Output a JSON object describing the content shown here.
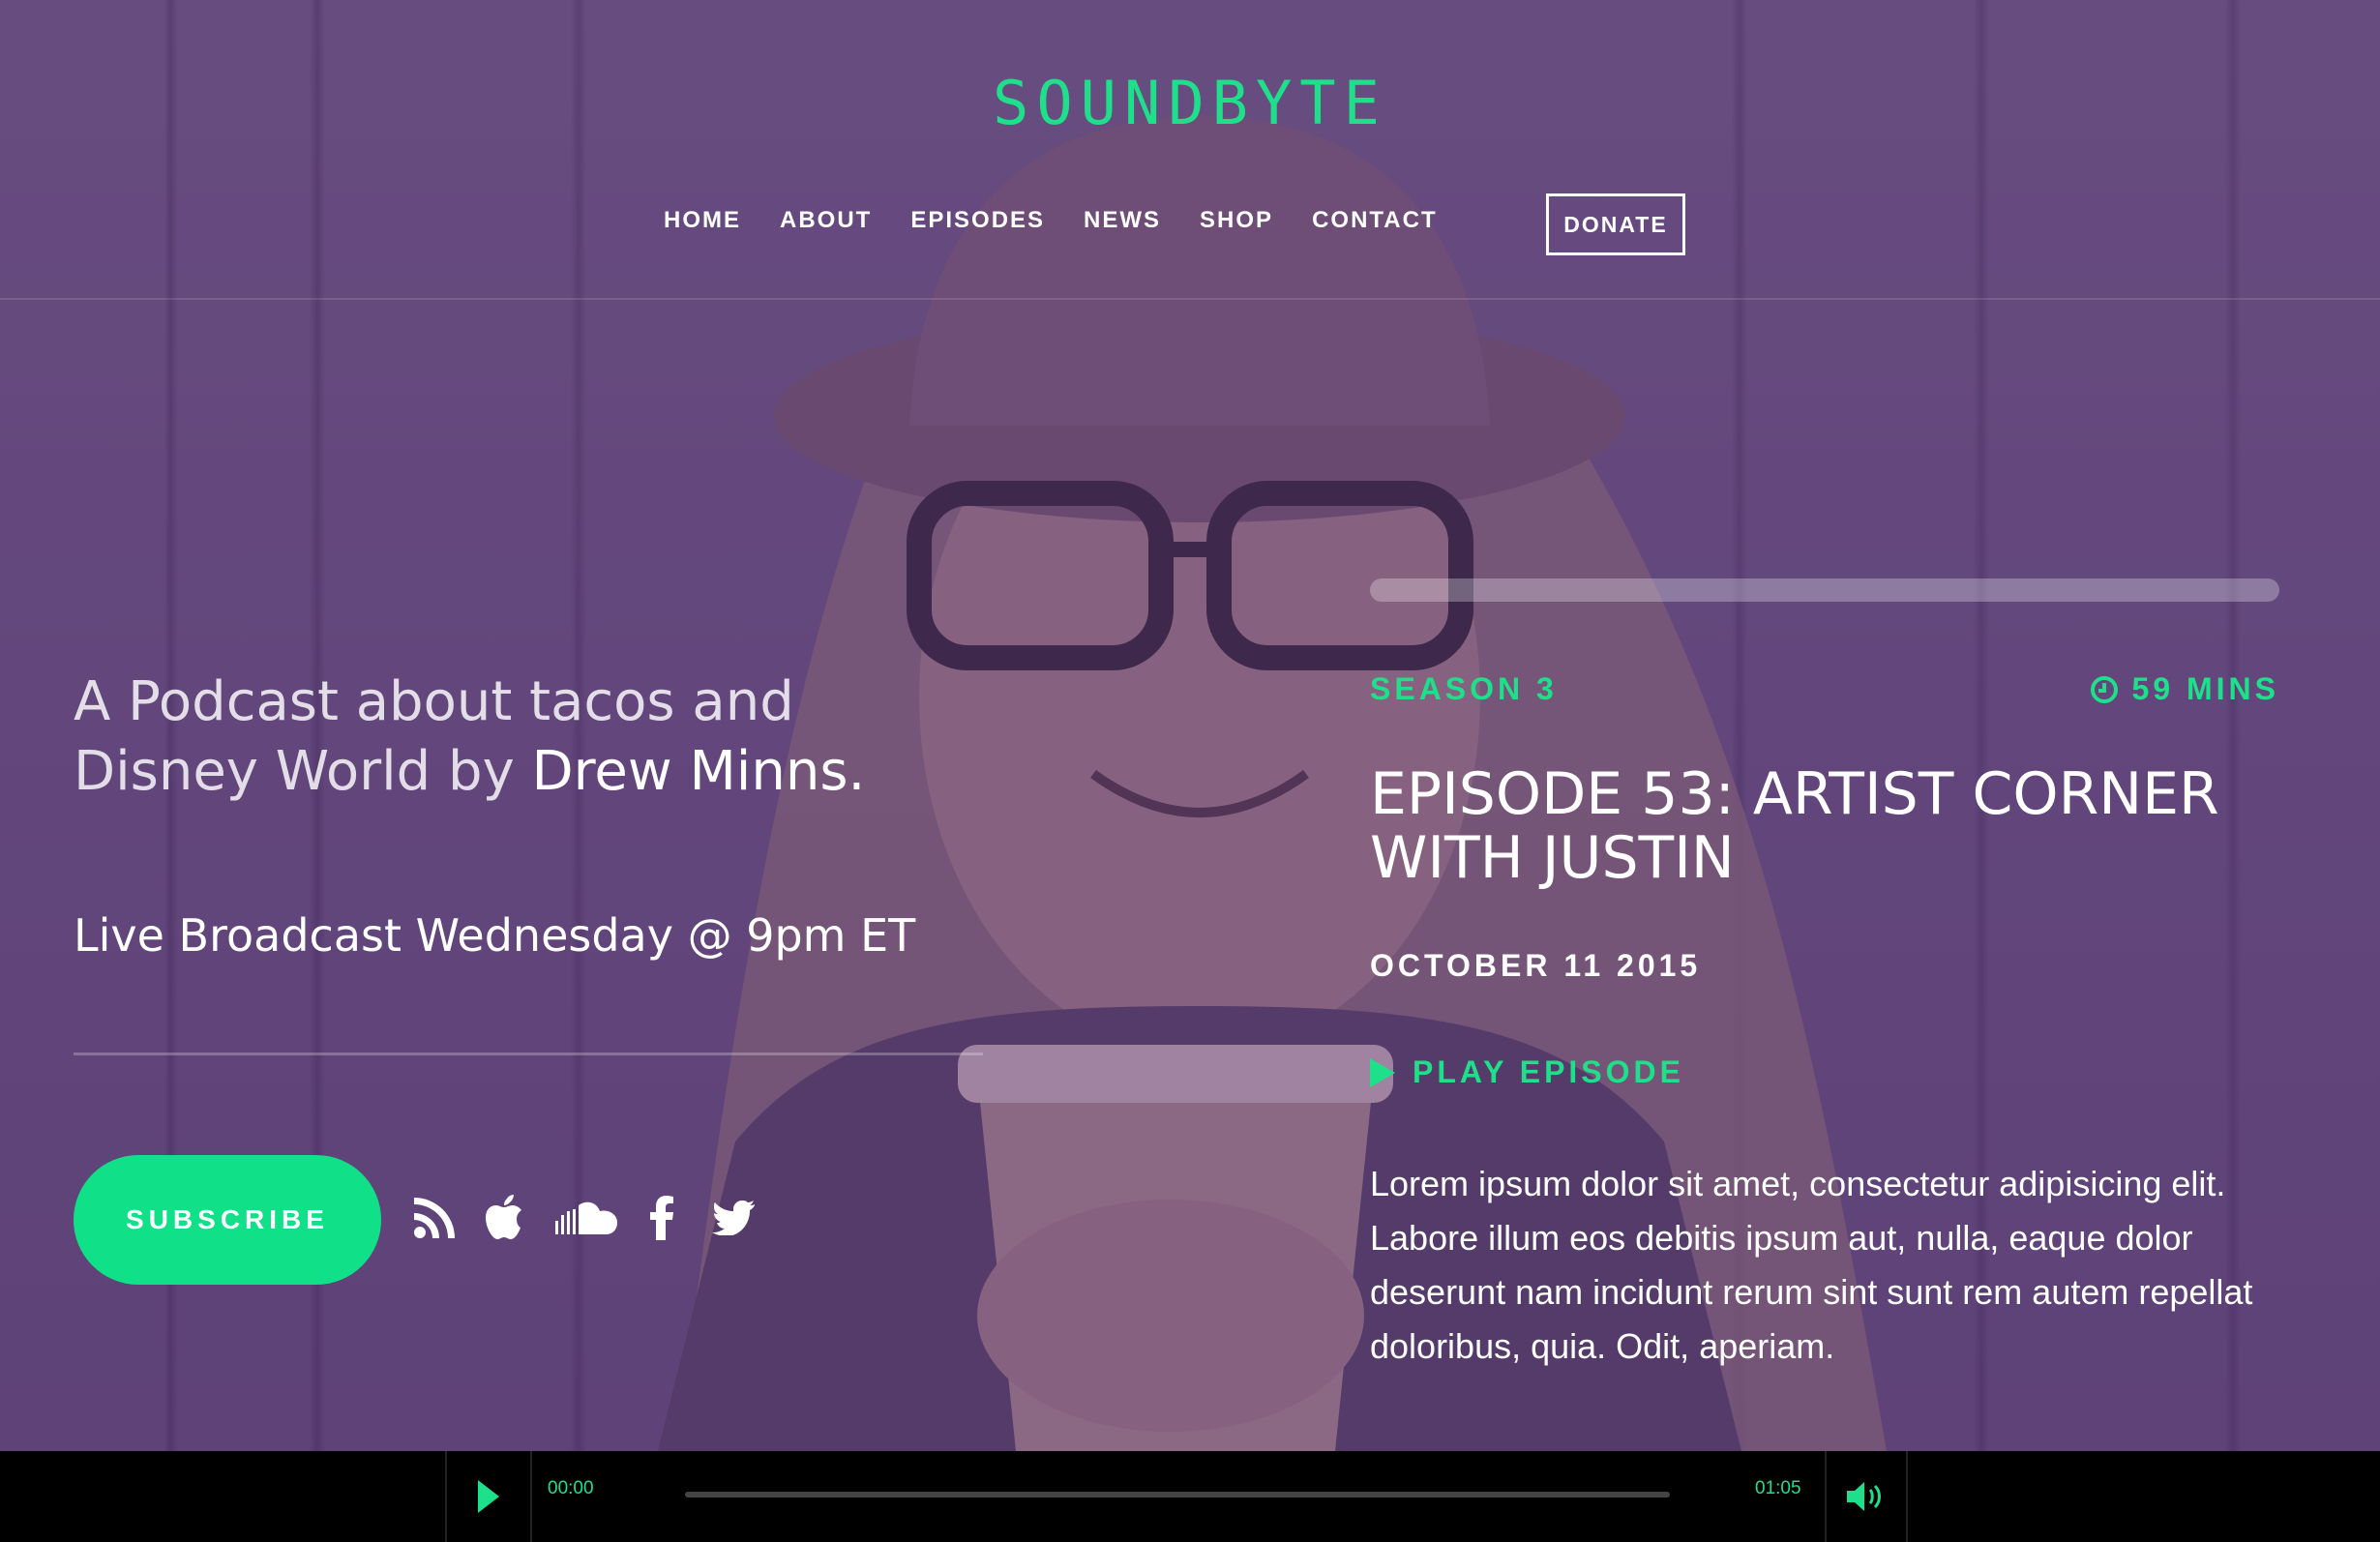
{
  "site": {
    "logo": "SOUNDBYTE"
  },
  "nav": {
    "items": [
      "HOME",
      "ABOUT",
      "EPISODES",
      "NEWS",
      "SHOP",
      "CONTACT"
    ],
    "donate": "DONATE"
  },
  "hero": {
    "tagline_prefix": "A Podcast about tacos and Disney World by ",
    "tagline_author": "Drew Minns.",
    "live": "Live Broadcast Wednesday @ 9pm ET",
    "subscribe": "SUBSCRIBE",
    "social_icons": [
      "rss-icon",
      "apple-icon",
      "soundcloud-icon",
      "facebook-icon",
      "twitter-icon"
    ]
  },
  "episode": {
    "season": "SEASON 3",
    "duration": "59 MINS",
    "title": "EPISODE 53: ARTIST CORNER WITH JUSTIN",
    "date": "OCTOBER 11 2015",
    "play_label": "PLAY EPISODE",
    "description": "Lorem ipsum dolor sit amet, consectetur adipisicing elit. Labore illum eos debitis ipsum aut, nulla, eaque dolor deserunt nam incidunt rerum sint sunt rem autem repellat doloribus, quia. Odit, aperiam."
  },
  "player": {
    "current_time": "00:00",
    "duration": "01:05"
  },
  "colors": {
    "accent": "#10e087",
    "overlay": "#623e80",
    "player_bg": "#000000"
  }
}
